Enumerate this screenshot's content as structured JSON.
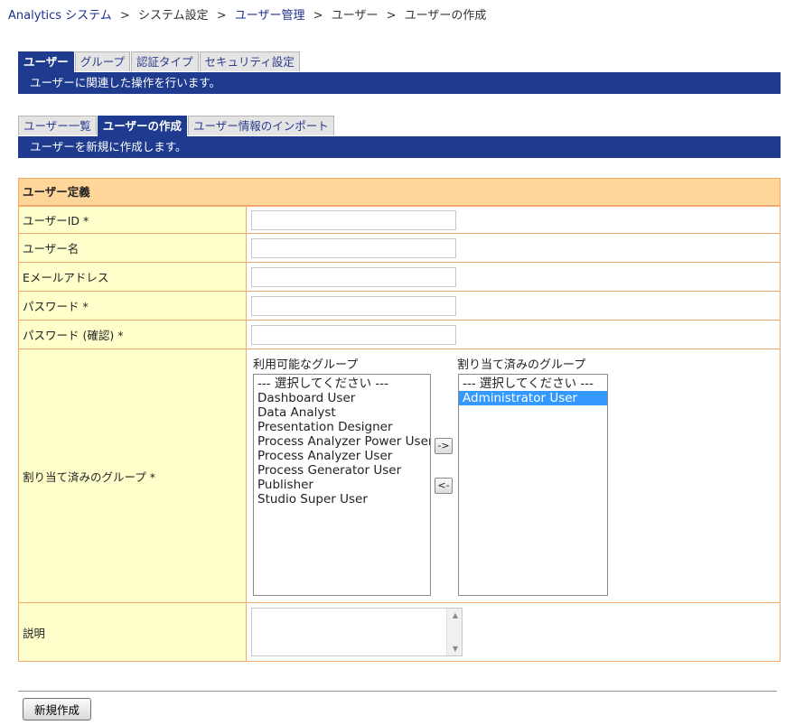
{
  "breadcrumb": {
    "root": "Analytics システム",
    "items": [
      "システム設定",
      "ユーザー管理",
      "ユーザー",
      "ユーザーの作成"
    ],
    "separator": ">"
  },
  "main_tabs": [
    "ユーザー",
    "グループ",
    "認証タイプ",
    "セキュリティ設定"
  ],
  "main_banner": "ユーザーに関連した操作を行います。",
  "sub_tabs": [
    "ユーザー一覧",
    "ユーザーの作成",
    "ユーザー情報のインポート"
  ],
  "sub_banner": "ユーザーを新規に作成します。",
  "form": {
    "section_title": "ユーザー定義",
    "labels": {
      "user_id": "ユーザーID *",
      "user_name": "ユーザー名",
      "email": "Eメールアドレス",
      "password": "パスワード *",
      "password_confirm": "パスワード (確認) *",
      "groups": "割り当て済みのグループ *",
      "description": "説明"
    },
    "values": {
      "user_id": "",
      "user_name": "",
      "email": "",
      "password": "",
      "password_confirm": "",
      "description": ""
    }
  },
  "groups": {
    "available_label": "利用可能なグループ",
    "assigned_label": "割り当て済みのグループ",
    "available": [
      "--- 選択してください ---",
      "Dashboard User",
      "Data Analyst",
      "Presentation Designer",
      "Process Analyzer Power User",
      "Process Analyzer User",
      "Process Generator User",
      "Publisher",
      "Studio Super User"
    ],
    "assigned": [
      "--- 選択してください ---",
      "Administrator User"
    ],
    "add_label": "->",
    "remove_label": "<-"
  },
  "submit_label": "新規作成",
  "colors": {
    "banner": "#1f3b8f",
    "header_bg": "#ffd69a",
    "label_bg": "#ffffcc",
    "border": "#f0a96a",
    "selection": "#3399ff"
  }
}
